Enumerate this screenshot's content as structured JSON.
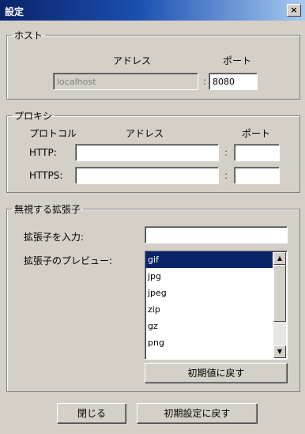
{
  "window": {
    "title": "設定",
    "close_label": "×"
  },
  "host": {
    "legend": "ホスト",
    "address_header": "アドレス",
    "port_header": "ポート",
    "address_value": "localhost",
    "port_value": "8080",
    "colon": ":"
  },
  "proxy": {
    "legend": "プロキシ",
    "protocol_header": "プロトコル",
    "address_header": "アドレス",
    "port_header": "ポート",
    "http_label": "HTTP:",
    "https_label": "HTTPS:",
    "colon": ":",
    "http_address": "",
    "http_port": "",
    "https_address": "",
    "https_port": ""
  },
  "extensions": {
    "legend": "無視する拡張子",
    "input_label": "拡張子を入力:",
    "input_value": "",
    "preview_label": "拡張子のプレビュー:",
    "items": [
      "gif",
      "jpg",
      "jpeg",
      "zip",
      "gz",
      "png"
    ],
    "selected_index": 0,
    "reset_button": "初期値に戻す"
  },
  "footer": {
    "close_button": "閉じる",
    "reset_all_button": "初期設定に戻す"
  }
}
